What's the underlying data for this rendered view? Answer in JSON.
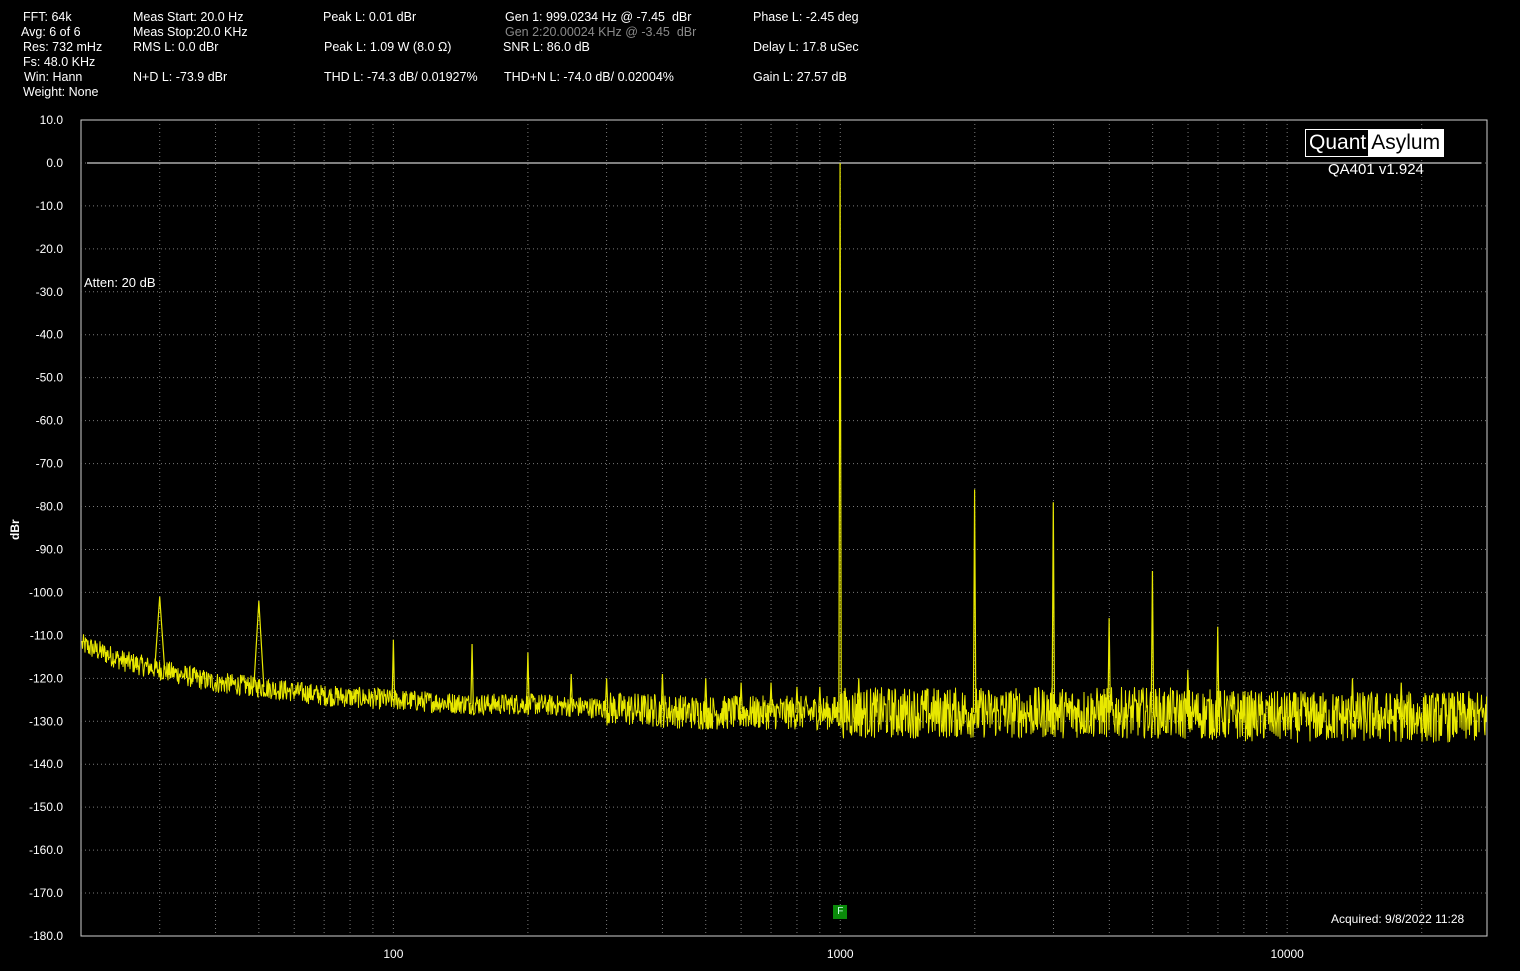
{
  "header": {
    "col1": [
      "FFT: 64k",
      "Avg: 6 of 6",
      "Res: 732 mHz",
      "Fs: 48.0 KHz",
      "Win: Hann",
      "Weight: None"
    ],
    "meas_start": "Meas Start: 20.0 Hz",
    "meas_stop": "Meas Stop:20.0 KHz",
    "rms": "RMS L: 0.0 dBr",
    "nd": "N+D L: -73.9 dBr",
    "peak_l": "Peak L: 0.01 dBr",
    "peak_w": "Peak L: 1.09 W (8.0 Ω)",
    "thd": "THD L: -74.3 dB/ 0.01927%",
    "gen1": "Gen 1: 999.0234 Hz @ -7.45  dBr",
    "gen2": "Gen 2:20.00024 KHz @ -3.45  dBr",
    "snr": "SNR L: 86.0 dB",
    "thdn": "THD+N L: -74.0 dB/ 0.02004%",
    "phase": "Phase L: -2.45 deg",
    "delay": "Delay L: 17.8 uSec",
    "gain": "Gain L: 27.57 dB"
  },
  "logo": {
    "left": "Quant",
    "right": "Asylum"
  },
  "version": "QA401 v1.924",
  "atten": "Atten: 20 dB",
  "acquired": "Acquired: 9/8/2022  11:28",
  "marker_label": "F",
  "colors": {
    "trace": "#e8e800",
    "grid": "#7a7a7a",
    "background": "#000000",
    "marker": "#0a8a0a"
  },
  "chart_data": {
    "type": "line",
    "xscale": "log",
    "xlim": [
      20,
      28000
    ],
    "ylim": [
      -180,
      10
    ],
    "ylabel": "dBr",
    "xlabel": "",
    "grid": true,
    "x_tick_labels": [
      {
        "value": 100,
        "label": "100"
      },
      {
        "value": 1000,
        "label": "1000"
      },
      {
        "value": 10000,
        "label": "10000"
      }
    ],
    "y_ticks": [
      10,
      0,
      -10,
      -20,
      -30,
      -40,
      -50,
      -60,
      -70,
      -80,
      -90,
      -100,
      -110,
      -120,
      -130,
      -140,
      -150,
      -160,
      -170,
      -180
    ],
    "y_tick_labels": [
      "10.0",
      "0.0",
      "-10.0",
      "-20.0",
      "-30.0",
      "-40.0",
      "-50.0",
      "-60.0",
      "-70.0",
      "-80.0",
      "-90.0",
      "-100.0",
      "-110.0",
      "-120.0",
      "-130.0",
      "-140.0",
      "-150.0",
      "-160.0",
      "-170.0",
      "-180.0"
    ],
    "reference_line": 0,
    "series": [
      {
        "noise_floor": [
          [
            20,
            -112
          ],
          [
            25,
            -116
          ],
          [
            30,
            -118
          ],
          [
            40,
            -121
          ],
          [
            50,
            -122
          ],
          [
            70,
            -124
          ],
          [
            100,
            -125
          ],
          [
            150,
            -126
          ],
          [
            200,
            -126
          ],
          [
            300,
            -127
          ],
          [
            500,
            -128
          ],
          [
            700,
            -128
          ],
          [
            1000,
            -128
          ],
          [
            2000,
            -128
          ],
          [
            5000,
            -128
          ],
          [
            10000,
            -129
          ],
          [
            20000,
            -129
          ],
          [
            28000,
            -129
          ]
        ],
        "peaks": [
          [
            999,
            0
          ],
          [
            1998,
            -76
          ],
          [
            2997,
            -79
          ],
          [
            3996,
            -106
          ],
          [
            4995,
            -95
          ],
          [
            5994,
            -118
          ],
          [
            6993,
            -108
          ],
          [
            30,
            -101
          ],
          [
            50,
            -102
          ],
          [
            100,
            -111
          ],
          [
            150,
            -112
          ],
          [
            200,
            -114
          ],
          [
            250,
            -119
          ],
          [
            300,
            -120
          ],
          [
            400,
            -119
          ],
          [
            500,
            -120
          ],
          [
            600,
            -121
          ],
          [
            700,
            -121
          ],
          [
            800,
            -122
          ],
          [
            900,
            -122
          ],
          [
            1100,
            -120
          ],
          [
            1200,
            -124
          ],
          [
            8000,
            -124
          ],
          [
            14000,
            -120
          ],
          [
            18000,
            -121
          ]
        ]
      }
    ],
    "marker": {
      "x": 1000,
      "label": "F"
    }
  }
}
